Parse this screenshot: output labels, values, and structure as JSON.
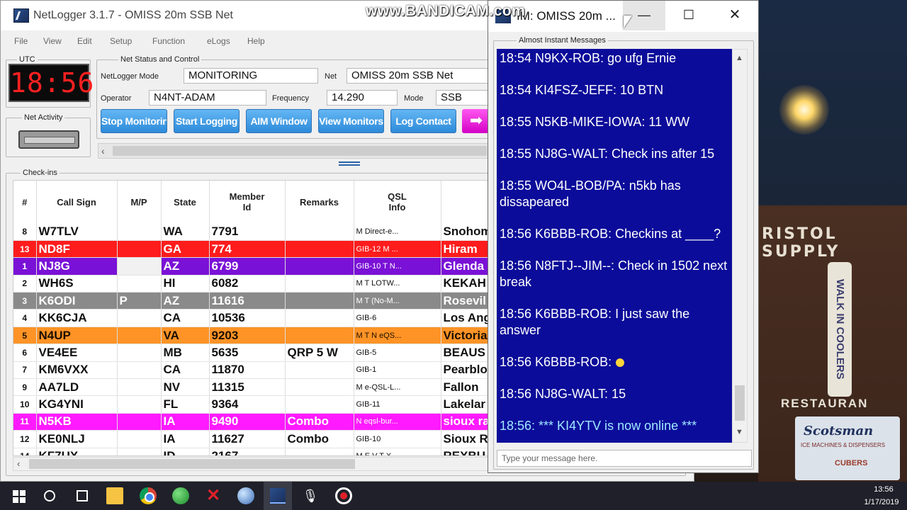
{
  "watermark": "www.BANDICAM.com",
  "main_window": {
    "title": "NetLogger 3.1.7 - OMISS 20m SSB Net",
    "menu": [
      "File",
      "View",
      "Edit",
      "Setup",
      "Function",
      "eLogs",
      "Help"
    ]
  },
  "utc": {
    "label": "UTC",
    "time": "18:56"
  },
  "net_activity": {
    "label": "Net Activity"
  },
  "net_status": {
    "label": "Net Status and Control",
    "mode_label": "NetLogger Mode",
    "mode_value": "MONITORING",
    "net_label": "Net",
    "net_value": "OMISS 20m SSB Net",
    "operator_label": "Operator",
    "operator_value": "N4NT-ADAM",
    "frequency_label": "Frequency",
    "frequency_value": "14.290",
    "modefield_label": "Mode",
    "modefield_value": "SSB",
    "buttons": {
      "stop_monitoring": "Stop Monitoring",
      "start_logging": "Start Logging",
      "aim_window": "AIM Window",
      "view_monitors": "View Monitors",
      "log_contact": "Log Contact",
      "arrow": "➡"
    }
  },
  "checkins": {
    "label": "Check-ins",
    "columns": [
      "#",
      "Call Sign",
      "M/P",
      "State",
      "Member\nId",
      "Remarks",
      "QSL\nInfo",
      ""
    ],
    "rows": [
      {
        "num": "8",
        "call": "W7TLV",
        "mp": "",
        "state": "WA",
        "member": "7791",
        "remarks": "",
        "qsl": "M Direct-e...",
        "city": "Snohom",
        "style": ""
      },
      {
        "num": "13",
        "call": "ND8F",
        "mp": "",
        "state": "GA",
        "member": "774",
        "remarks": "",
        "qsl": "GIB-12 M ...",
        "city": "Hiram",
        "style": "row-red"
      },
      {
        "num": "1",
        "call": "NJ8G",
        "mp": "",
        "state": "AZ",
        "member": "6799",
        "remarks": "",
        "qsl": "GIB-10 T N...",
        "city": "Glenda",
        "style": "row-purple"
      },
      {
        "num": "2",
        "call": "WH6S",
        "mp": "",
        "state": "HI",
        "member": "6082",
        "remarks": "",
        "qsl": "M T LOTW...",
        "city": "KEKAH",
        "style": ""
      },
      {
        "num": "3",
        "call": "K6ODI",
        "mp": "P",
        "state": "AZ",
        "member": "11616",
        "remarks": "",
        "qsl": "M T (No-M...",
        "city": "Rosevil",
        "style": "row-gray"
      },
      {
        "num": "4",
        "call": "KK6CJA",
        "mp": "",
        "state": "CA",
        "member": "10536",
        "remarks": "",
        "qsl": "GIB-6",
        "city": "Los Ang",
        "style": ""
      },
      {
        "num": "5",
        "call": "N4UP",
        "mp": "",
        "state": "VA",
        "member": "9203",
        "remarks": "",
        "qsl": "M T N eQS...",
        "city": "Victoria",
        "style": "row-orange"
      },
      {
        "num": "6",
        "call": "VE4EE",
        "mp": "",
        "state": "MB",
        "member": "5635",
        "remarks": "QRP 5 W",
        "qsl": "GIB-5",
        "city": "BEAUS",
        "style": ""
      },
      {
        "num": "7",
        "call": "KM6VXX",
        "mp": "",
        "state": "CA",
        "member": "11870",
        "remarks": "",
        "qsl": "GIB-1",
        "city": "Pearblo",
        "style": ""
      },
      {
        "num": "9",
        "call": "AA7LD",
        "mp": "",
        "state": "NV",
        "member": "11315",
        "remarks": "",
        "qsl": "M e-QSL-L...",
        "city": "Fallon",
        "style": ""
      },
      {
        "num": "10",
        "call": "KG4YNI",
        "mp": "",
        "state": "FL",
        "member": "9364",
        "remarks": "",
        "qsl": "GIB-11",
        "city": "Lakelar",
        "style": ""
      },
      {
        "num": "11",
        "call": "N5KB",
        "mp": "",
        "state": "IA",
        "member": "9490",
        "remarks": "Combo",
        "qsl": "N eqsl-bur...",
        "city": "sioux ra",
        "style": "row-magenta"
      },
      {
        "num": "12",
        "call": "KE0NLJ",
        "mp": "",
        "state": "IA",
        "member": "11627",
        "remarks": "Combo",
        "qsl": "GIB-10",
        "city": "Sioux R",
        "style": ""
      },
      {
        "num": "14",
        "call": "KF7UX",
        "mp": "",
        "state": "ID",
        "member": "2167",
        "remarks": "",
        "qsl": "M E V T X",
        "city": "REXBU",
        "style": ""
      }
    ]
  },
  "aim_window": {
    "title": "IM: OMISS 20m ...",
    "min": "—",
    "max": "☐",
    "close": "✕",
    "group_label": "Almost Instant Messages",
    "messages": [
      {
        "text": "18:54 N9KX-ROB: go ufg Ernie",
        "system": false
      },
      {
        "text": "18:54 KI4FSZ-JEFF: 10 BTN",
        "system": false
      },
      {
        "text": "18:55 N5KB-MIKE-IOWA: 11 WW",
        "system": false
      },
      {
        "text": "18:55 NJ8G-WALT: Check ins after 15",
        "system": false
      },
      {
        "text": "18:55 WO4L-BOB/PA: n5kb has dissapeared",
        "system": false
      },
      {
        "text": "18:56 K6BBB-ROB: Checkins at ____?",
        "system": false
      },
      {
        "text": "18:56 N8FTJ--JIM--: Check in 1502 next break",
        "system": false
      },
      {
        "text": "18:56 K6BBB-ROB: I just saw the answer",
        "system": false
      },
      {
        "text": "18:56 K6BBB-ROB:",
        "system": false,
        "smiley": true
      },
      {
        "text": "18:56 NJ8G-WALT: 15",
        "system": false
      },
      {
        "text": "18:56: *** KI4YTV is now online ***",
        "system": true
      }
    ],
    "input_placeholder": "Type your message here."
  },
  "background_signs": {
    "bristol": "RISTOL SUPPLY",
    "walkin": "WALK IN COOLERS",
    "restaurant": "RESTAURAN",
    "scotsman": "Scotsman",
    "scotsman_tag": "ICE MACHINES & DISPENSERS",
    "cubers": "CUBERS"
  },
  "taskbar": {
    "time": "13:56",
    "date": "1/17/2019",
    "icons": [
      "windows-start-icon",
      "search-icon",
      "task-view-icon",
      "file-explorer-icon",
      "chrome-icon",
      "globe-icon",
      "x-app-icon",
      "network-icon",
      "netlogger-icon",
      "microphone-icon",
      "record-icon"
    ]
  }
}
